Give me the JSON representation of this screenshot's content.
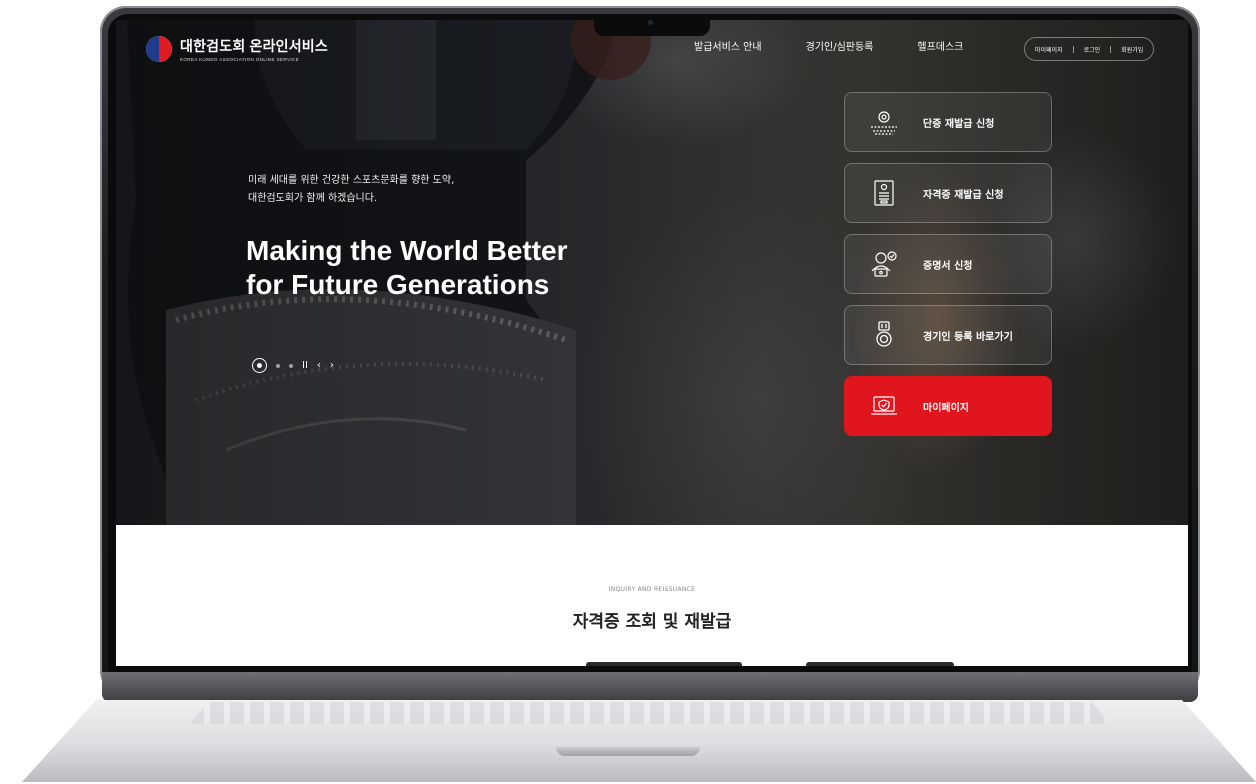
{
  "header": {
    "logo_title": "대한검도회 온라인서비스",
    "logo_subtitle": "KOREA KUMDO ASSOCIATION ONLINE SERVICE",
    "nav": [
      "발급서비스 안내",
      "경기인/심판등록",
      "헬프데스크"
    ],
    "util": [
      "마이페이지",
      "로그인",
      "회원가입"
    ]
  },
  "hero": {
    "tagline_line1": "미래 세대를 위한 건강한 스포츠문화를 향한 도약,",
    "tagline_line2": "대한검도회가 함께 하겠습니다.",
    "headline_line1": "Making the World Better",
    "headline_line2": "for Future Generations",
    "controls": {
      "pause": "II",
      "prev": "‹",
      "next": "›"
    }
  },
  "quick_menu": [
    {
      "label": "단증 재발급 신청",
      "icon": "certificate-ribbon-icon",
      "active": false
    },
    {
      "label": "자격증 재발급 신청",
      "icon": "id-document-icon",
      "active": false
    },
    {
      "label": "증명서 신청",
      "icon": "user-check-icon",
      "active": false
    },
    {
      "label": "경기인 등록 바로가기",
      "icon": "medal-icon",
      "active": false
    },
    {
      "label": "마이페이지",
      "icon": "laptop-shield-icon",
      "active": true
    }
  ],
  "section": {
    "eyebrow": "INQUIRY AND REISSUANCE",
    "title": "자격증 조회 및 재발급"
  },
  "colors": {
    "accent": "#e0151e",
    "hero_dark": "#202226"
  }
}
